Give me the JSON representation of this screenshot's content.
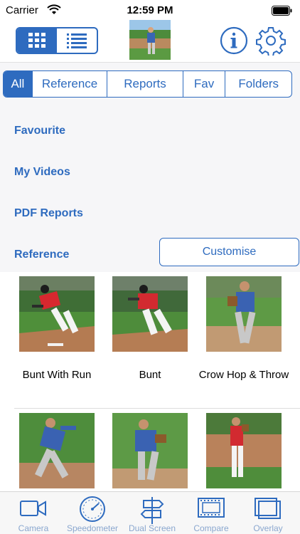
{
  "status": {
    "carrier": "Carrier",
    "time": "12:59 PM"
  },
  "filters": [
    {
      "label": "All",
      "active": true
    },
    {
      "label": "Reference",
      "active": false
    },
    {
      "label": "Reports",
      "active": false
    },
    {
      "label": "Fav",
      "active": false
    },
    {
      "label": "Folders",
      "active": false
    }
  ],
  "list": {
    "favourite": "Favourite",
    "my_videos": "My Videos",
    "pdf_reports": "PDF Reports",
    "reference": "Reference"
  },
  "customise_label": "Customise",
  "grid": [
    {
      "caption": "Bunt With Run"
    },
    {
      "caption": "Bunt"
    },
    {
      "caption": "Crow Hop & Throw"
    },
    {
      "caption": ""
    },
    {
      "caption": ""
    },
    {
      "caption": ""
    }
  ],
  "tabbar": {
    "camera": "Camera",
    "speedometer": "Speedometer",
    "dual_screen": "Dual Screen",
    "compare": "Compare",
    "overlay": "Overlay"
  },
  "colors": {
    "accent": "#2e6bbf",
    "tab_inactive": "#8aa7cf"
  }
}
